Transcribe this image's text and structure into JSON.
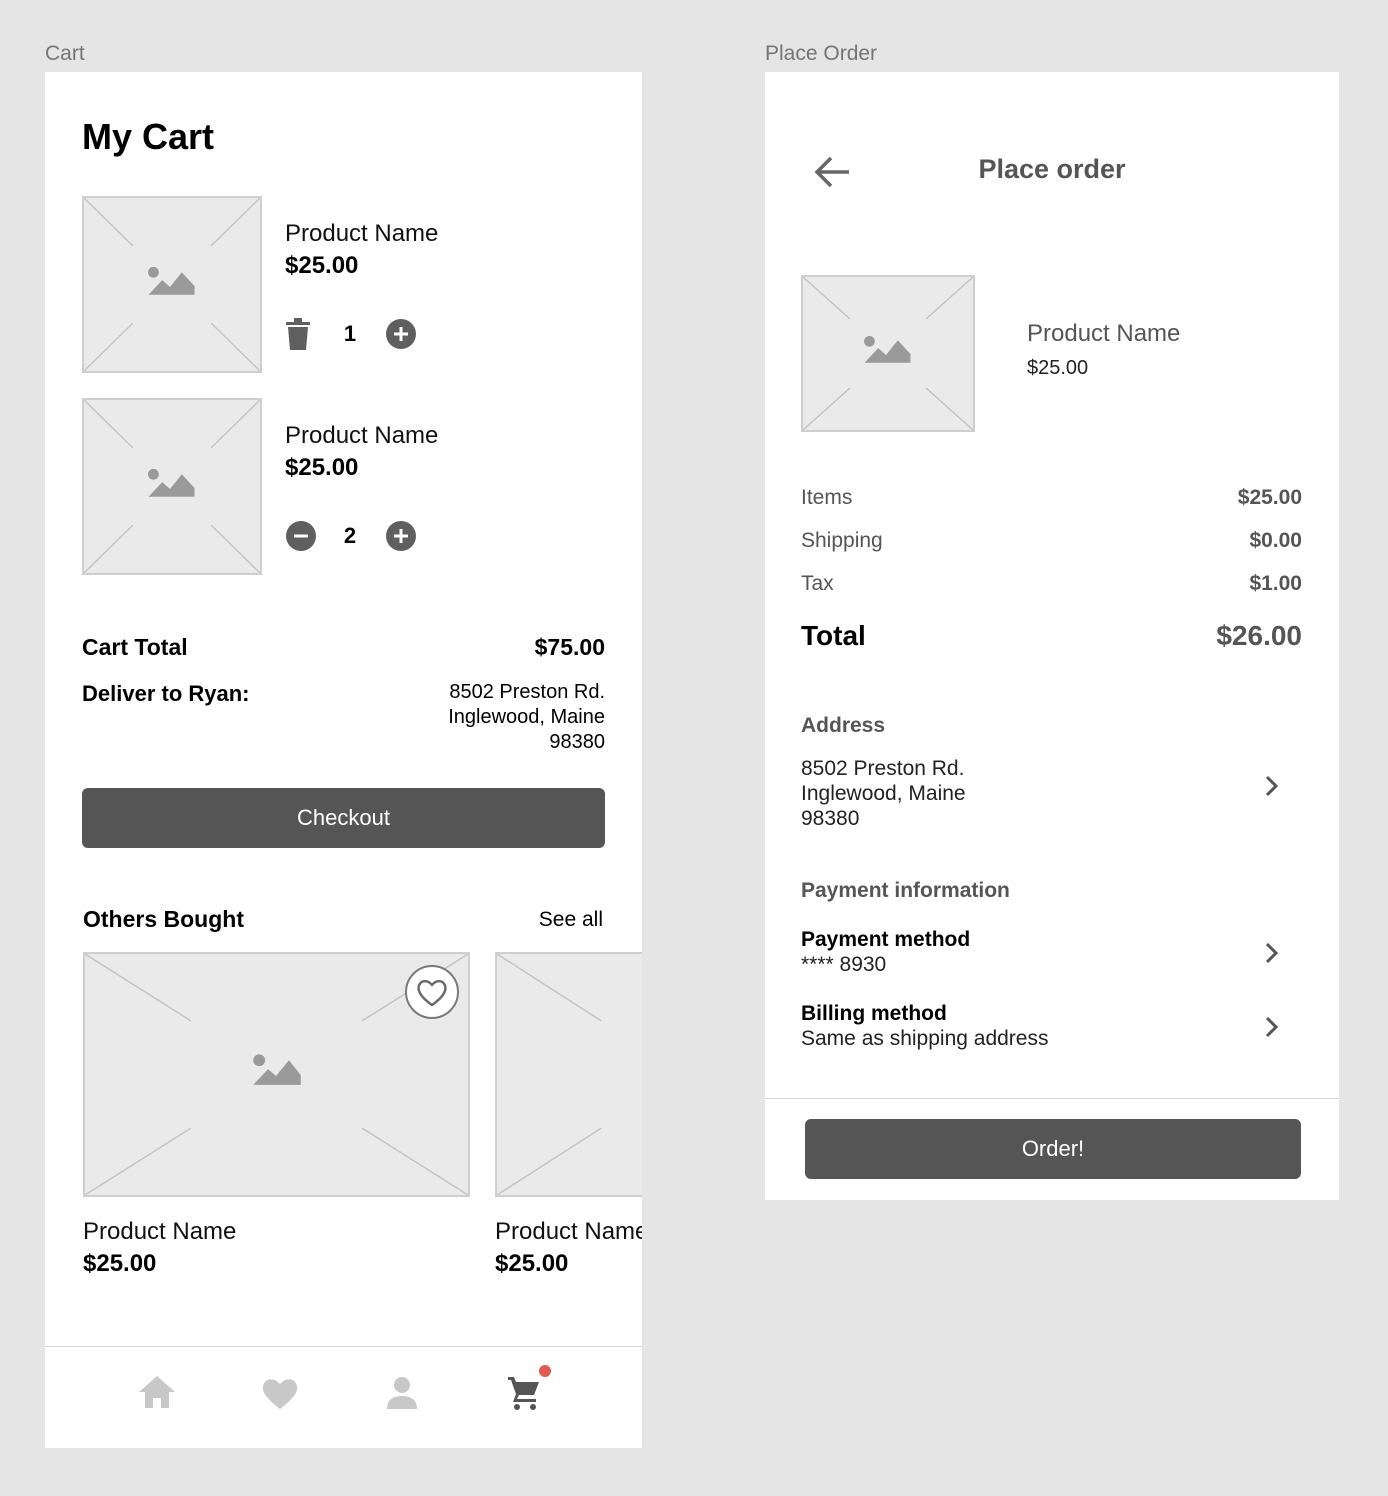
{
  "frames": {
    "cart_label": "Cart",
    "place_order_label": "Place Order"
  },
  "cart": {
    "title": "My Cart",
    "items": [
      {
        "name": "Product Name",
        "price": "$25.00",
        "quantity": "1",
        "left_action": "trash-icon"
      },
      {
        "name": "Product Name",
        "price": "$25.00",
        "quantity": "2",
        "left_action": "minus-icon"
      }
    ],
    "total_label": "Cart Total",
    "total_value": "$75.00",
    "deliver_label": "Deliver to Ryan:",
    "address_line1": "8502 Preston Rd.",
    "address_line2": "Inglewood, Maine",
    "address_line3": "98380",
    "checkout_label": "Checkout",
    "others_title": "Others Bought",
    "see_all": "See all",
    "others": [
      {
        "name": "Product Name",
        "price": "$25.00"
      },
      {
        "name": "Product Name",
        "price": "$25.00"
      }
    ],
    "nav": [
      "home-icon",
      "heart-icon",
      "person-icon",
      "cart-icon"
    ],
    "cart_badge_color": "#e05a4f"
  },
  "place_order": {
    "title": "Place order",
    "product_name": "Product Name",
    "product_price": "$25.00",
    "summary": [
      {
        "label": "Items",
        "value": "$25.00"
      },
      {
        "label": "Shipping",
        "value": "$0.00"
      },
      {
        "label": "Tax",
        "value": "$1.00"
      }
    ],
    "total_label": "Total",
    "total_value": "$26.00",
    "address_heading": "Address",
    "address_line1": "8502 Preston Rd.",
    "address_line2": "Inglewood, Maine",
    "address_line3": "98380",
    "payment_heading": "Payment information",
    "payment_method_label": "Payment method",
    "payment_method_value": "**** 8930",
    "billing_method_label": "Billing method",
    "billing_method_value": "Same as shipping address",
    "order_button": "Order!"
  },
  "colors": {
    "background": "#e5e5e5",
    "button": "#555555",
    "placeholder": "#eaeaea"
  }
}
